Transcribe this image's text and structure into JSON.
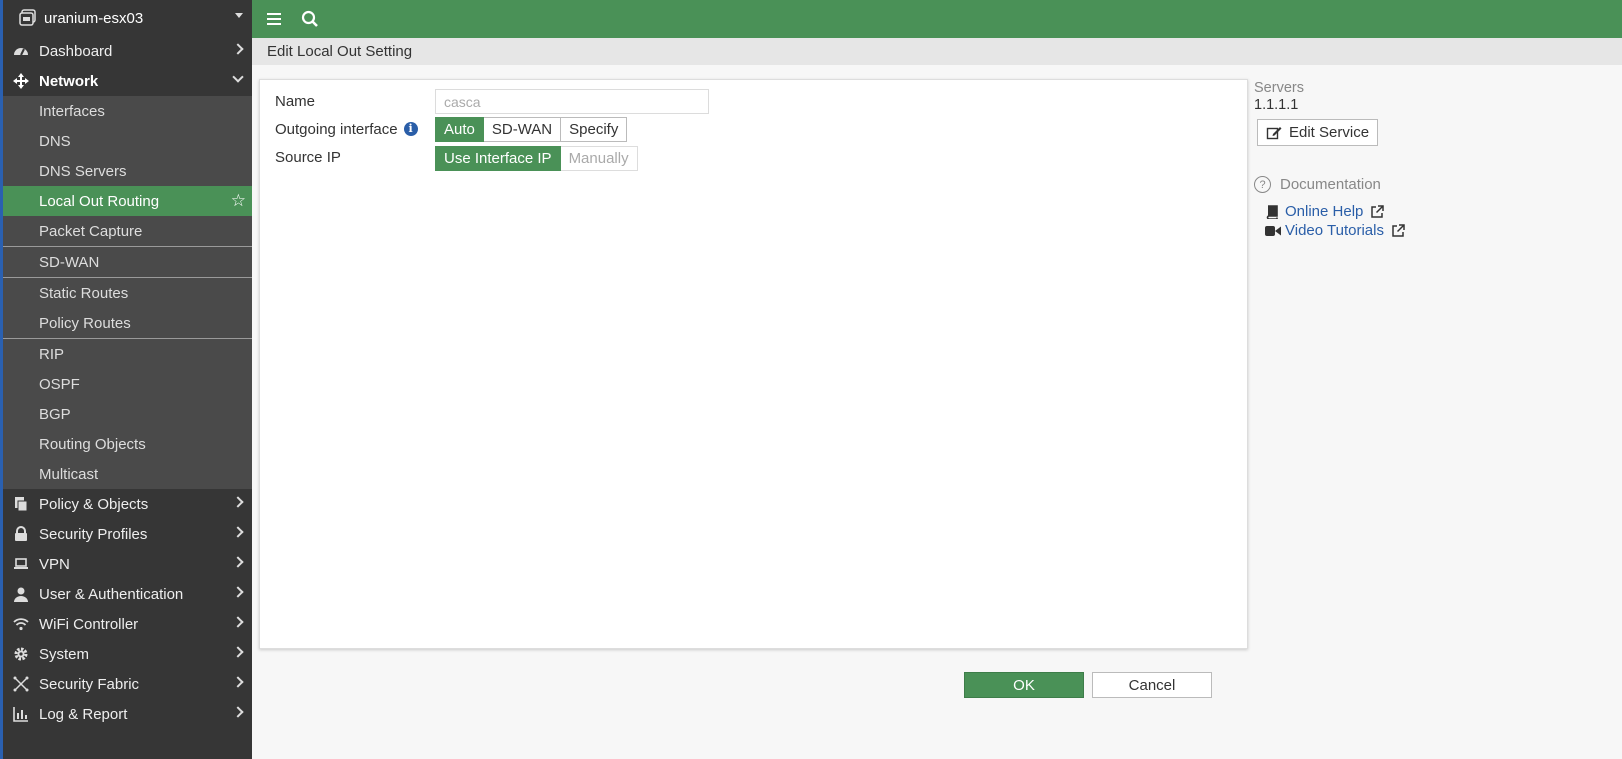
{
  "device": {
    "name": "uranium-esx03"
  },
  "sidebar": {
    "items": [
      {
        "label": "Dashboard",
        "icon": "dashboard-icon"
      },
      {
        "label": "Network",
        "icon": "network-icon"
      },
      {
        "label": "Policy & Objects",
        "icon": "policy-icon"
      },
      {
        "label": "Security Profiles",
        "icon": "lock-icon"
      },
      {
        "label": "VPN",
        "icon": "laptop-icon"
      },
      {
        "label": "User & Authentication",
        "icon": "user-icon"
      },
      {
        "label": "WiFi Controller",
        "icon": "wifi-icon"
      },
      {
        "label": "System",
        "icon": "gear-icon"
      },
      {
        "label": "Security Fabric",
        "icon": "fabric-icon"
      },
      {
        "label": "Log & Report",
        "icon": "chart-icon"
      }
    ],
    "network_sub": [
      "Interfaces",
      "DNS",
      "DNS Servers",
      "Local Out Routing",
      "Packet Capture",
      "SD-WAN",
      "Static Routes",
      "Policy Routes",
      "RIP",
      "OSPF",
      "BGP",
      "Routing Objects",
      "Multicast"
    ]
  },
  "breadcrumb": {
    "title": "Edit Local Out Setting"
  },
  "form": {
    "name_label": "Name",
    "name_value": "casca",
    "outgoing_label": "Outgoing interface",
    "outgoing_options": [
      "Auto",
      "SD-WAN",
      "Specify"
    ],
    "outgoing_selected": "Auto",
    "source_ip_label": "Source IP",
    "source_ip_options": [
      "Use Interface IP",
      "Manually"
    ],
    "source_ip_selected": "Use Interface IP"
  },
  "footer": {
    "ok_label": "OK",
    "cancel_label": "Cancel"
  },
  "right_panel": {
    "servers_label": "Servers",
    "servers_value": "1.1.1.1",
    "edit_service_label": "Edit Service",
    "documentation_label": "Documentation",
    "online_help_label": "Online Help",
    "video_tutorials_label": "Video Tutorials"
  },
  "colors": {
    "brand_green": "#4a9157",
    "sidebar_bg": "#363636",
    "link_blue": "#2a5ea8"
  }
}
